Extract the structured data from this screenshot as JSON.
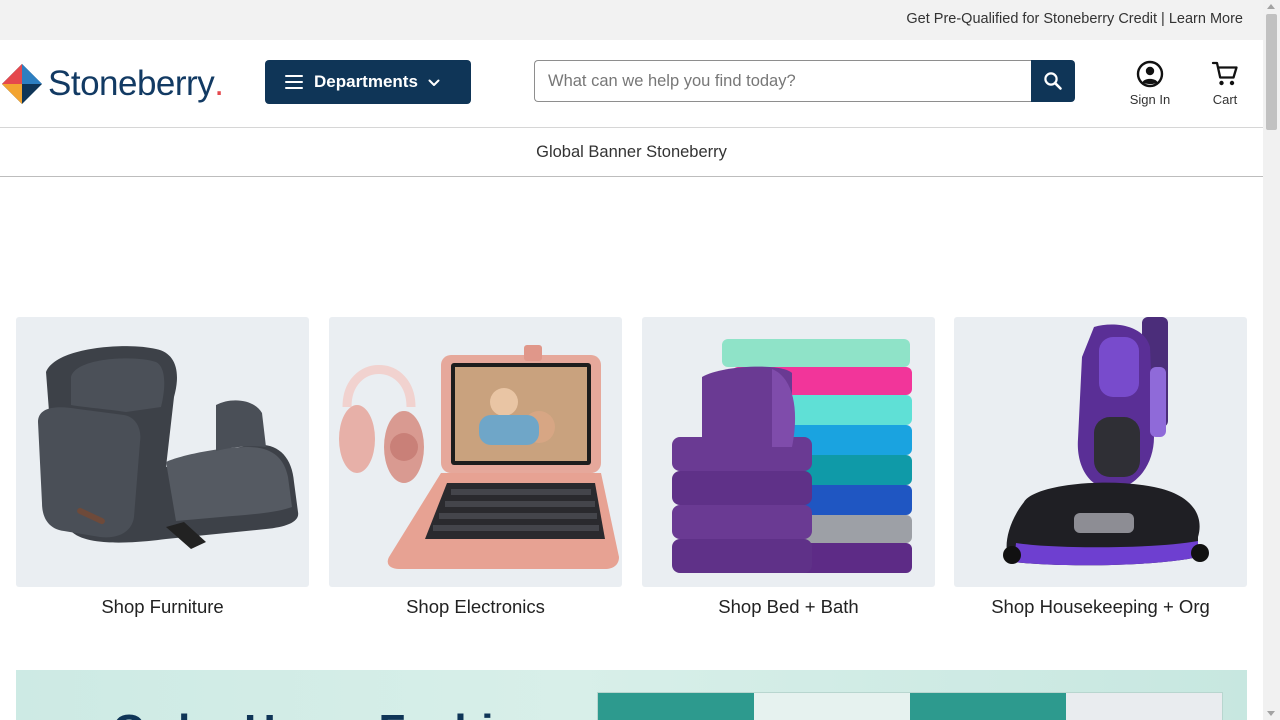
{
  "topbar": {
    "promo_text": "Get Pre-Qualified for Stoneberry Credit",
    "separator": " | ",
    "learn_more": "Learn More"
  },
  "header": {
    "logo_text": "Stoneberry",
    "logo_dot": ".",
    "departments_label": "Departments",
    "search_placeholder": "What can we help you find today?",
    "search_value": "",
    "sign_in_label": "Sign In",
    "cart_label": "Cart"
  },
  "global_banner": {
    "text": "Global Banner Stoneberry"
  },
  "categories": [
    {
      "label": "Shop Furniture",
      "icon": "recliner-image"
    },
    {
      "label": "Shop Electronics",
      "icon": "tablet-headphones-image"
    },
    {
      "label": "Shop Bed + Bath",
      "icon": "towels-image"
    },
    {
      "label": "Shop Housekeeping + Org",
      "icon": "vacuum-image"
    }
  ],
  "promo_banner": {
    "headline": "Order Home Fashions"
  },
  "colors": {
    "brand_navy": "#0f3557",
    "topbar_bg": "#f2f2f2",
    "card_bg": "#eaeef2"
  }
}
